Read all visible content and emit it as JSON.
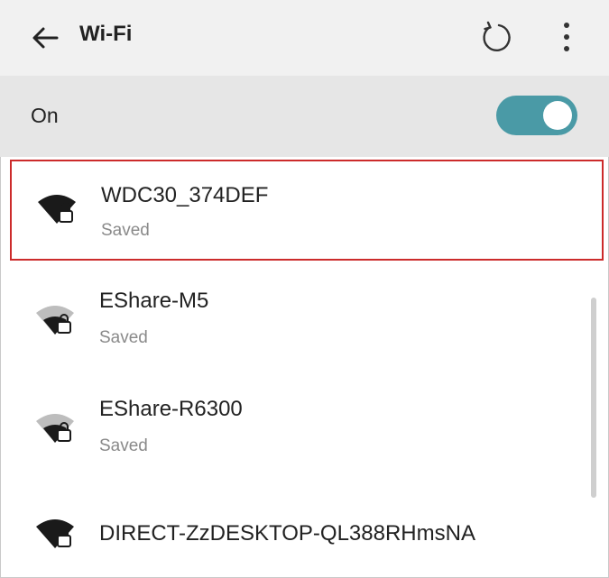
{
  "header": {
    "title": "Wi-Fi",
    "back_icon": "arrow-left-icon",
    "refresh_icon": "refresh-icon",
    "menu_icon": "more-vert-icon"
  },
  "wifi_toggle": {
    "label": "On",
    "state": "on",
    "accent_color": "#4a9aa6"
  },
  "networks": [
    {
      "name": "WDC30_374DEF",
      "status": "Saved",
      "locked": true,
      "selected": true
    },
    {
      "name": "EShare-M5",
      "status": "Saved",
      "locked": true,
      "selected": false
    },
    {
      "name": "EShare-R6300",
      "status": "Saved",
      "locked": true,
      "selected": false
    },
    {
      "name": "DIRECT-ZzDESKTOP-QL388RHmsNA",
      "status": "",
      "locked": true,
      "selected": false
    }
  ],
  "highlight_color": "#cc2b2b"
}
